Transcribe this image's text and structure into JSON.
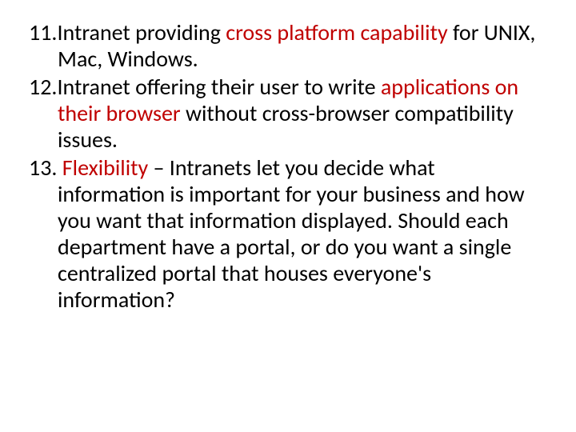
{
  "items": [
    {
      "num": "11.",
      "pre": "Intranet providing ",
      "red": "cross platform capability",
      "post": " for UNIX, Mac, Windows."
    },
    {
      "num": "12.",
      "pre": "Intranet offering their user to write ",
      "red": "applications on their browser",
      "post": " without cross-browser compatibility issues."
    },
    {
      "num": "13. ",
      "pre": "",
      "red": "Flexibility",
      "post": " – Intranets let you decide what information is important for your business and how you want that information displayed. Should each department have a portal, or do you want a single centralized portal that houses everyone's information?"
    }
  ]
}
